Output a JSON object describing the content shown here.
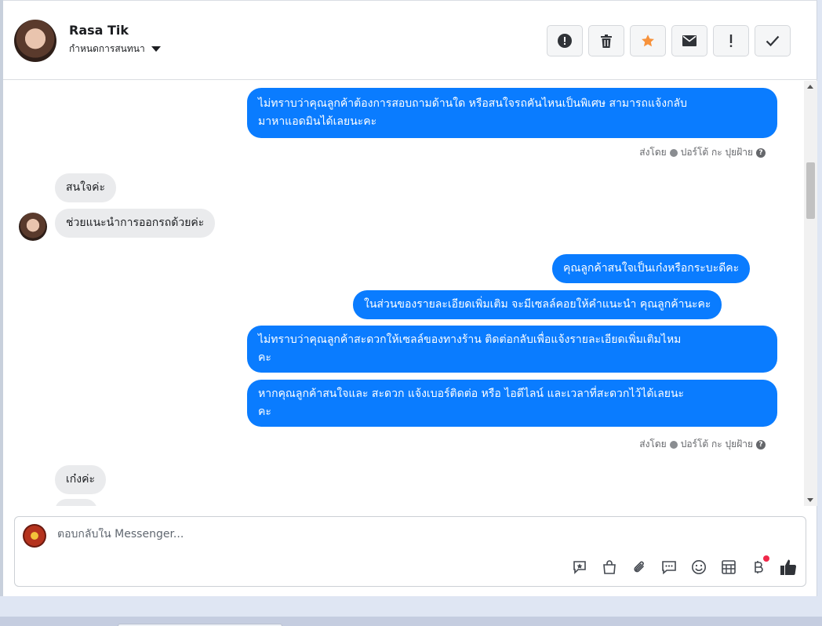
{
  "header": {
    "name": "Rasa Tik",
    "subtitle": "กำหนดการสนทนา",
    "actions": [
      {
        "name": "report-button",
        "icon": "alert-circle-icon"
      },
      {
        "name": "delete-button",
        "icon": "trash-icon"
      },
      {
        "name": "star-button",
        "icon": "star-icon"
      },
      {
        "name": "mark-unread-button",
        "icon": "envelope-icon"
      },
      {
        "name": "mark-spam-button",
        "icon": "exclamation-icon"
      },
      {
        "name": "mark-done-button",
        "icon": "checkmark-icon"
      }
    ]
  },
  "messages": {
    "out1": "ไม่ทราบว่าคุณลูกค้าต้องการสอบถามด้านใด หรือสนใจรถคันไหนเป็นพิเศษ สามารถแจ้งกลับ\nมาหาแอดมินได้เลยนะคะ",
    "sent_label": "ส่งโดย",
    "sender": "ปอร์โต้ กะ ปุยฝ้าย",
    "in1": "สนใจค่ะ",
    "in2": "ช่วยแนะนำการออกรถด้วยค่ะ",
    "out2": "คุณลูกค้าสนใจเป็นเก๋งหรือกระบะดีคะ",
    "out3": "ในส่วนของรายละเอียดเพิ่มเติม จะมีเซลล์คอยให้คำแนะนำ คุณลูกค้านะคะ",
    "out4": "ไม่ทราบว่าคุณลูกค้าสะดวกให้เซลล์ของทางร้าน ติดต่อกลับเพื่อแจ้งรายละเอียดเพิ่มเติมไหม\nคะ",
    "out5": "หากคุณลูกค้าสนใจและ สะดวก แจ้งเบอร์ติดต่อ หรือ ไอดีไลน์ และเวลาที่สะดวกไว้ได้เลยนะ\nคะ",
    "in3": "เก๋งค่ะ"
  },
  "composer": {
    "placeholder": "ตอบกลับใน Messenger..."
  },
  "colors": {
    "accent": "#0a7cff",
    "incoming_bubble": "#eaebed",
    "star": "#f7923b"
  }
}
